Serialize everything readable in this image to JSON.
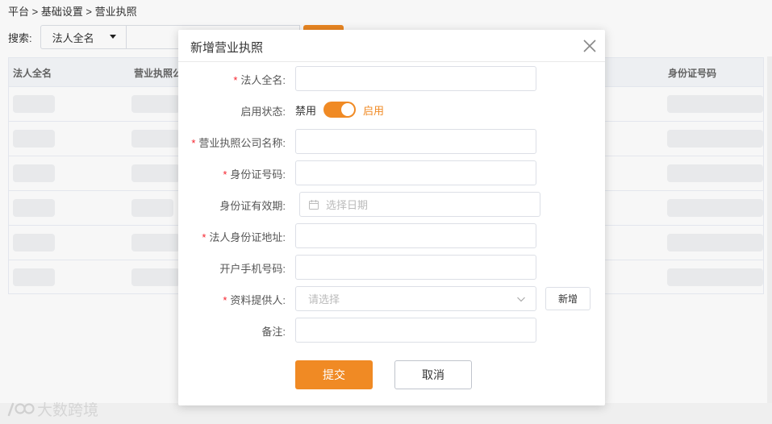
{
  "breadcrumb": "平台 > 基础设置 > 营业执照",
  "search": {
    "label": "搜索:",
    "field_selected": "法人全名"
  },
  "table": {
    "headers": [
      "法人全名",
      "营业执照公",
      "身份证号码"
    ]
  },
  "modal": {
    "title": "新增营业执照",
    "fields": {
      "legal_name": {
        "label": "法人全名:",
        "required": true,
        "value": ""
      },
      "status": {
        "label": "启用状态:",
        "off_label": "禁用",
        "on_label": "启用",
        "enabled": true
      },
      "company_name": {
        "label": "营业执照公司名称:",
        "required": true,
        "value": ""
      },
      "id_number": {
        "label": "身份证号码:",
        "required": true,
        "value": ""
      },
      "id_validity": {
        "label": "身份证有效期:",
        "placeholder": "选择日期"
      },
      "id_address": {
        "label": "法人身份证地址:",
        "required": true,
        "value": ""
      },
      "phone": {
        "label": "开户手机号码:",
        "value": ""
      },
      "provider": {
        "label": "资料提供人:",
        "required": true,
        "placeholder": "请选择",
        "add_label": "新增"
      },
      "remark": {
        "label": "备注:",
        "value": ""
      }
    },
    "submit_label": "提交",
    "cancel_label": "取消"
  },
  "watermark": "大数跨境",
  "colors": {
    "accent": "#f08a24",
    "required": "#f5222d"
  }
}
